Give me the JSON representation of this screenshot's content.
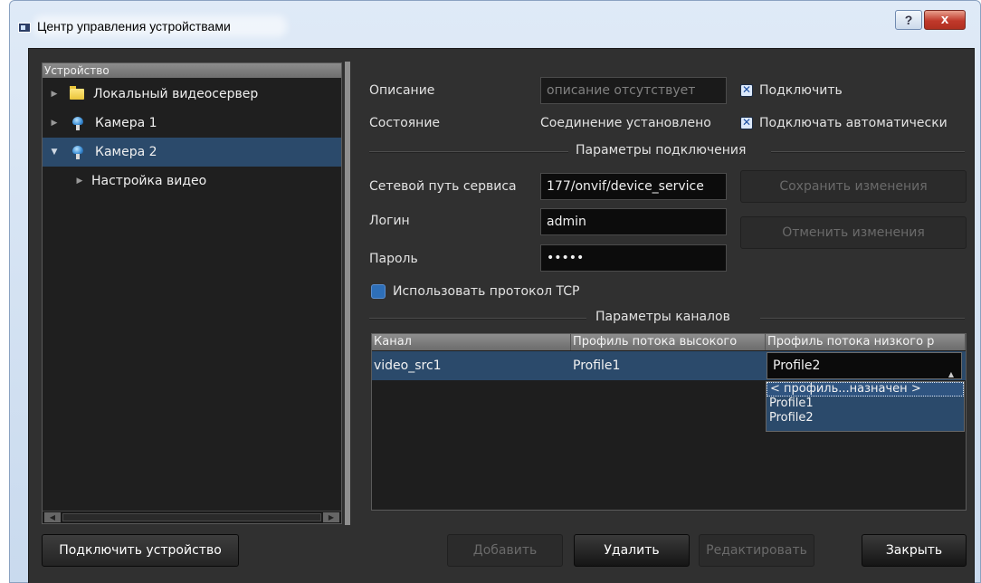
{
  "window": {
    "title": "Центр управления устройствами",
    "help_label": "?",
    "close_label": "x"
  },
  "tree": {
    "header": "Устройство",
    "items": [
      {
        "label": "Локальный видеосервер",
        "icon": "folder-icon",
        "expanded": false,
        "selected": false
      },
      {
        "label": "Камера 1",
        "icon": "camera-icon",
        "expanded": false,
        "selected": false
      },
      {
        "label": "Камера 2",
        "icon": "camera-icon",
        "expanded": true,
        "selected": true
      },
      {
        "label": "Настройка видео",
        "icon": "",
        "expanded": false,
        "selected": false
      }
    ]
  },
  "form": {
    "description_label": "Описание",
    "description_placeholder": "описание отсутствует",
    "connect_label": "Подключить",
    "connect_checked": true,
    "state_label": "Состояние",
    "state_value": "Соединение установлено",
    "autoconnect_label": "Подключать автоматически",
    "autoconnect_checked": true,
    "connection_section": "Параметры подключения",
    "service_path_label": "Сетевой путь сервиса",
    "service_path_value": "177/onvif/device_service",
    "login_label": "Логин",
    "login_value": "admin",
    "password_label": "Пароль",
    "password_value": "•••••",
    "save_label": "Сохранить изменения",
    "cancel_label": "Отменить изменения",
    "tcp_label": "Использовать протокол TCP",
    "tcp_checked": false,
    "channels_section": "Параметры каналов"
  },
  "channels_table": {
    "columns": [
      "Канал",
      "Профиль потока высокого",
      "Профиль потока низкого р"
    ],
    "rows": [
      {
        "channel": "video_src1",
        "high_profile": "Profile1",
        "low_profile": "Profile2"
      }
    ],
    "dropdown_options": [
      "< профиль...назначен >",
      "Profile1",
      "Profile2"
    ]
  },
  "footer": {
    "connect_device_label": "Подключить устройство",
    "add_label": "Добавить",
    "delete_label": "Удалить",
    "edit_label": "Редактировать",
    "close_label": "Закрыть"
  },
  "colors": {
    "selection": "#2b4a6b",
    "background": "#303030"
  }
}
